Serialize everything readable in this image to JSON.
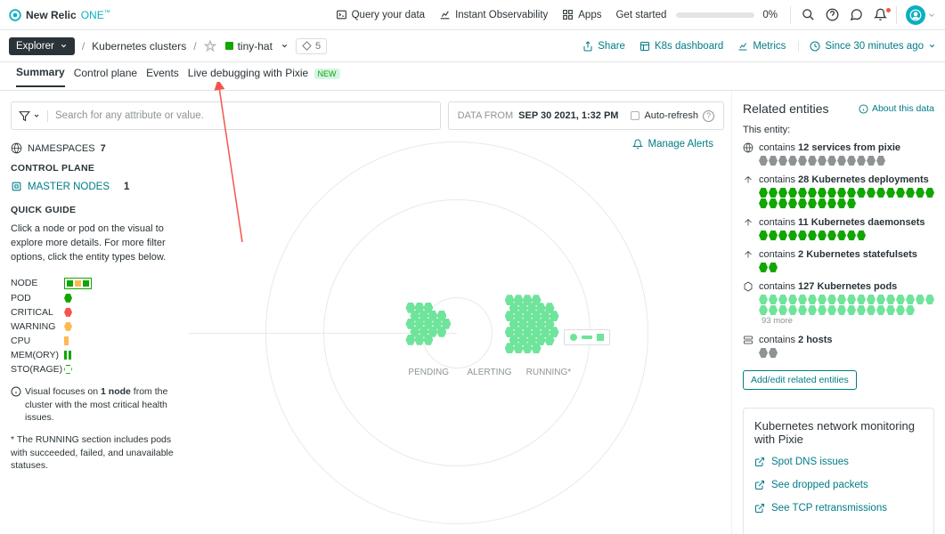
{
  "brand": {
    "name": "New Relic",
    "suffix": "ONE",
    "tm": "™"
  },
  "header": {
    "query": "Query your data",
    "instant": "Instant Observability",
    "apps": "Apps",
    "getStarted": "Get started",
    "pct": "0%"
  },
  "subheader": {
    "explorer": "Explorer",
    "crumb1": "Kubernetes clusters",
    "entity": "tiny-hat",
    "count": "5",
    "share": "Share",
    "k8s": "K8s dashboard",
    "metrics": "Metrics",
    "since": "Since 30 minutes ago"
  },
  "tabs": {
    "summary": "Summary",
    "control": "Control plane",
    "events": "Events",
    "live": "Live debugging with Pixie",
    "new": "NEW"
  },
  "filter": {
    "placeholder": "Search for any attribute or value.",
    "dateLabel": "DATA FROM",
    "dateValue": "SEP 30 2021, 1:32 PM",
    "autoRefresh": "Auto-refresh"
  },
  "manageAlerts": "Manage Alerts",
  "side": {
    "namespaces": "NAMESPACES",
    "nsCount": "7",
    "controlPlane": "CONTROL PLANE",
    "masterNodes": "MASTER NODES",
    "masterCount": "1",
    "quickGuide": "QUICK GUIDE",
    "guideText": "Click a node or pod on the visual to explore more details. For more filter options, click the entity types below.",
    "legend": {
      "node": "NODE",
      "pod": "POD",
      "critical": "CRITICAL",
      "warning": "WARNING",
      "cpu": "CPU",
      "mem": "MEM(ORY)",
      "sto": "STO(RAGE)"
    },
    "info1a": "Visual focuses on ",
    "info1b": "1 node",
    "info1c": " from the cluster with the most critical health issues.",
    "foot": "* The RUNNING section includes pods with succeeded, failed, and unavailable statuses."
  },
  "viz": {
    "pending": "PENDING",
    "alerting": "ALERTING",
    "running": "RUNNING*"
  },
  "related": {
    "title": "Related entities",
    "about": "About this data",
    "thisEntity": "This entity:",
    "items": [
      {
        "pre": "contains ",
        "bold": "12 services from pixie",
        "chips": 13,
        "cls": "grey-chip",
        "icon": "globe"
      },
      {
        "pre": "contains ",
        "bold": "28 Kubernetes deployments",
        "chips": 28,
        "cls": "green-chip",
        "icon": "arrowup"
      },
      {
        "pre": "contains ",
        "bold": "11 Kubernetes daemonsets",
        "chips": 11,
        "cls": "green-chip",
        "icon": "arrowup"
      },
      {
        "pre": "contains ",
        "bold": "2 Kubernetes statefulsets",
        "chips": 2,
        "cls": "green-chip",
        "icon": "arrowup"
      },
      {
        "pre": "contains ",
        "bold": "127 Kubernetes pods",
        "chips": 34,
        "cls": "lgreen-chip",
        "icon": "hex",
        "more": "93 more"
      },
      {
        "pre": "contains ",
        "bold": "2 hosts",
        "chips": 2,
        "cls": "grey-chip",
        "icon": "server"
      }
    ],
    "addEdit": "Add/edit related entities"
  },
  "pixie": {
    "title": "Kubernetes network monitoring with Pixie",
    "links": [
      "Spot DNS issues",
      "See dropped packets",
      "See TCP retransmissions"
    ]
  }
}
